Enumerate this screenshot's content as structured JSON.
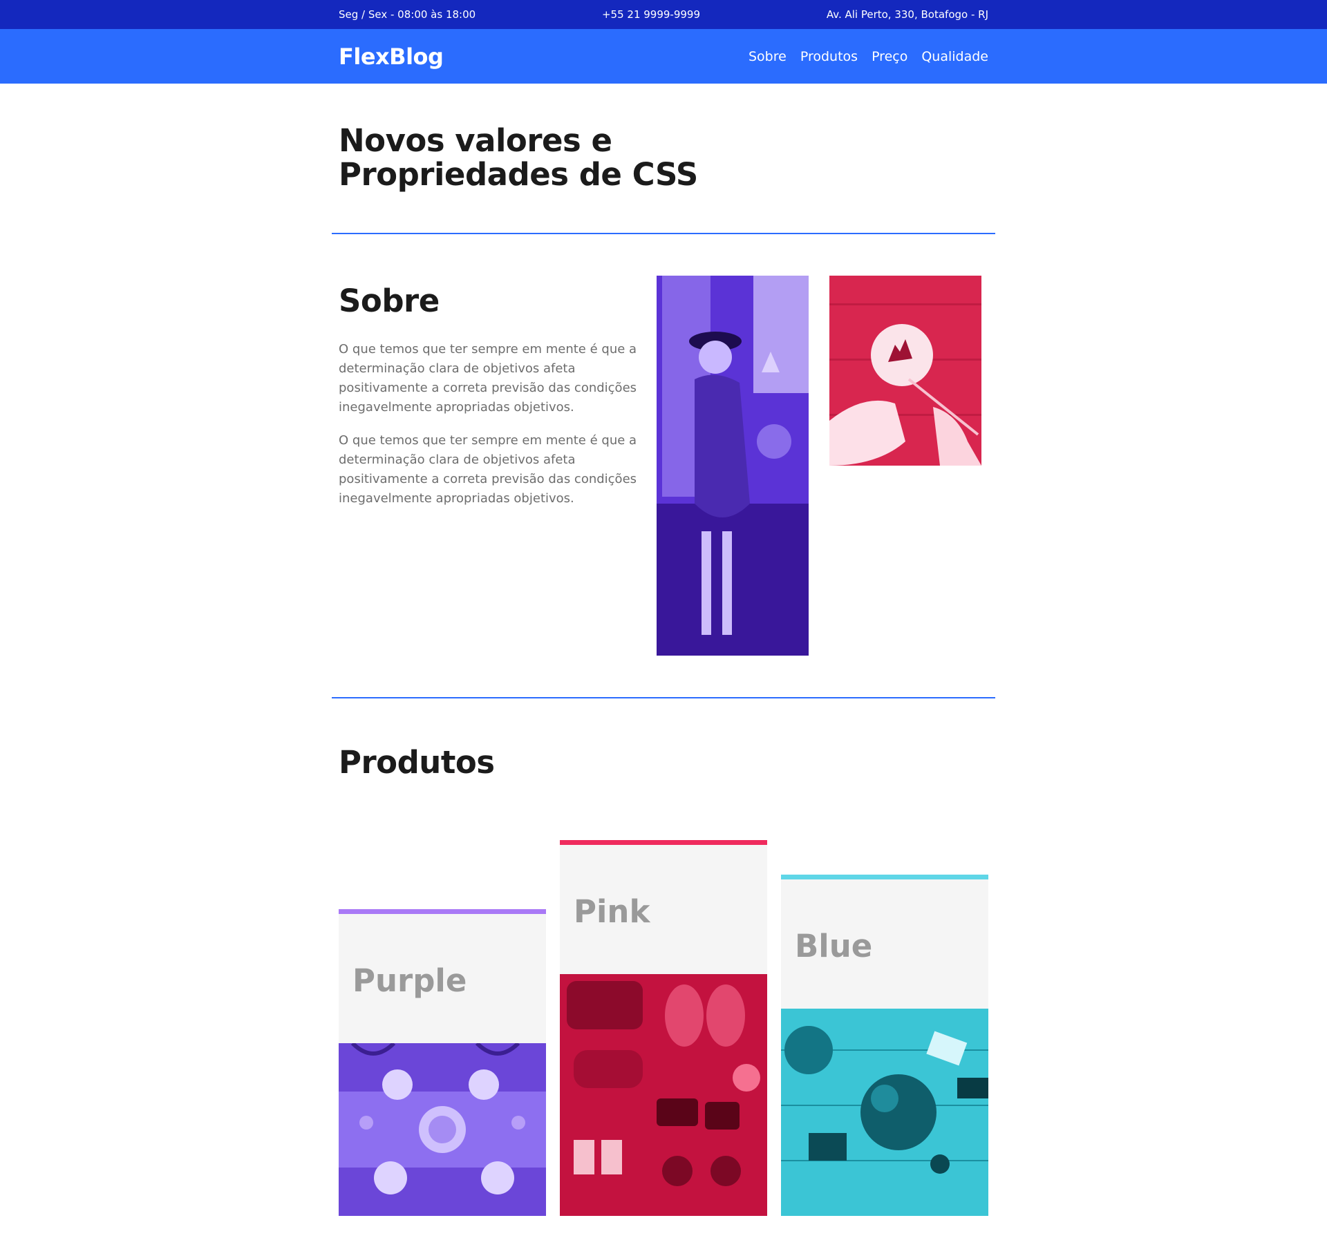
{
  "topbar": {
    "hours": "Seg / Sex - 08:00 às 18:00",
    "phone": "+55 21 9999-9999",
    "address": "Av. Ali Perto, 330, Botafogo - RJ"
  },
  "navbar": {
    "logo": "FlexBlog",
    "links": [
      "Sobre",
      "Produtos",
      "Preço",
      "Qualidade"
    ]
  },
  "hero": {
    "title": "Novos valores e Propriedades de CSS"
  },
  "sobre": {
    "title": "Sobre",
    "paragraphs": [
      "O que temos que ter sempre em mente é que a determinação clara de objetivos afeta positivamente a correta previsão das condições inegavelmente apropriadas objetivos.",
      "O que temos que ter sempre em mente é que a determinação clara de objetivos afeta positivamente a correta previsão das condições inegavelmente apropriadas objetivos."
    ]
  },
  "produtos": {
    "title": "Produtos",
    "cards": [
      {
        "label": "Purple",
        "accent": "#a979f6"
      },
      {
        "label": "Pink",
        "accent": "#ef2b5d"
      },
      {
        "label": "Blue",
        "accent": "#5fd6e7"
      }
    ]
  },
  "colors": {
    "topbar": "#1428be",
    "navbar": "#2b6cfe",
    "divider": "#2b6cfe"
  }
}
